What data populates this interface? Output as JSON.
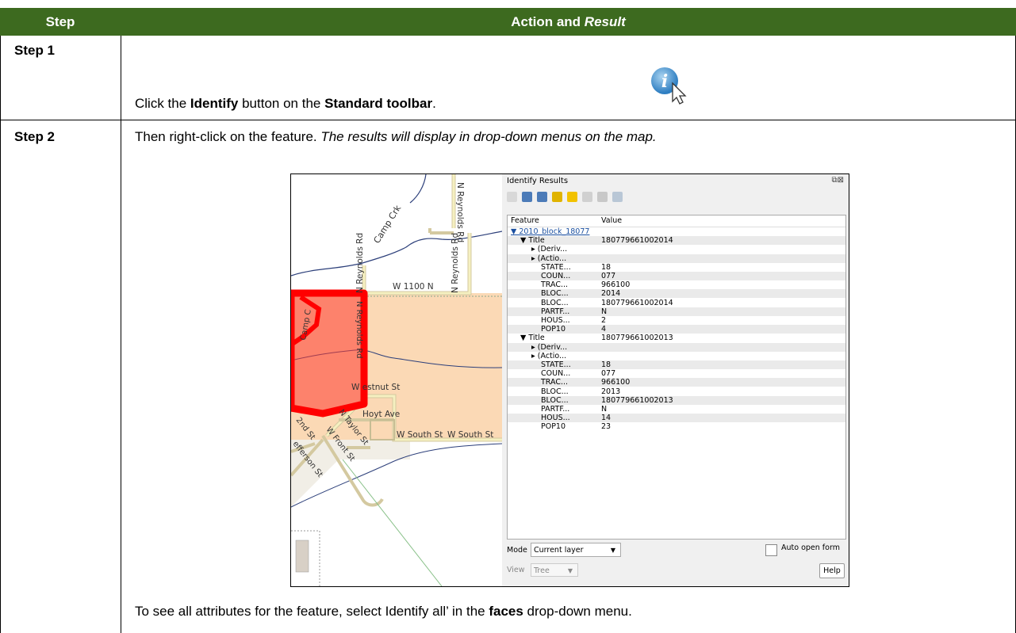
{
  "table": {
    "header": {
      "step": "Step",
      "action": "Action and ",
      "result_word": "Result"
    },
    "step1": {
      "label": "Step 1",
      "t1": "Click the ",
      "b1": "Identify",
      "t2": " button on the ",
      "b2": "Standard toolbar",
      "t3": "."
    },
    "step2": {
      "label": "Step 2",
      "t1": "Then right-click on the feature. ",
      "i1": "The results will display in drop-down menus on the map.",
      "b_t1": "To see all attributes for the feature, select Identify all’ in the ",
      "b_b1": "faces",
      "b_t2": " drop-down menu."
    },
    "colors": {
      "header_bg": "#3d6a1f",
      "header_text": "#ffffff"
    }
  },
  "icon": {
    "name": "identify-tool-icon"
  },
  "map": {
    "labels": {
      "camp_crk": "Camp Crk",
      "n_reynolds_rd_top": "N Reynolds Rd",
      "n_reynolds_rd_mid": "N Reynolds Rd",
      "n_reynolds_rd_left": "N Reynolds Rd",
      "w_1100_n": "W 1100 N",
      "camp_c": "Camp C",
      "n_reynolds_vert": "N Reynolds Rd",
      "chestnut": "W  estnut St",
      "hoyt": "Hoyt Ave",
      "n_taylor": "N Taylor St",
      "w_south_1": "W South St",
      "w_south_2": "W South St",
      "w_front": "W Front St",
      "nd_st": "2nd St",
      "jefferson": "efferson St"
    },
    "colors": {
      "highlight": "#ff0000",
      "fill": "#fbd9b5",
      "road": "#f5f0c0",
      "water": "#2c3f7a"
    }
  },
  "identify_panel": {
    "title": "Identify Results",
    "controls": "⧉⊠",
    "columns": {
      "feature": "Feature",
      "value": "Value"
    },
    "rows": [
      {
        "key": "▼  2010_block_18077",
        "value": "",
        "indent": 0,
        "selected": true
      },
      {
        "key": "▼  Title",
        "value": "180779661002014",
        "indent": 1
      },
      {
        "key": "▸  (Deriv...",
        "value": "",
        "indent": 2
      },
      {
        "key": "▸  (Actio...",
        "value": "",
        "indent": 2
      },
      {
        "key": "STATE...",
        "value": "18",
        "indent": 3
      },
      {
        "key": "COUN...",
        "value": "077",
        "indent": 3
      },
      {
        "key": "TRAC...",
        "value": "966100",
        "indent": 3
      },
      {
        "key": "BLOC...",
        "value": "2014",
        "indent": 3
      },
      {
        "key": "BLOC...",
        "value": "180779661002014",
        "indent": 3
      },
      {
        "key": "PARTF...",
        "value": "N",
        "indent": 3
      },
      {
        "key": "HOUS...",
        "value": "2",
        "indent": 3
      },
      {
        "key": "POP10",
        "value": "4",
        "indent": 3
      },
      {
        "key": "▼  Title",
        "value": "180779661002013",
        "indent": 1
      },
      {
        "key": "▸  (Deriv...",
        "value": "",
        "indent": 2
      },
      {
        "key": "▸  (Actio...",
        "value": "",
        "indent": 2
      },
      {
        "key": "STATE...",
        "value": "18",
        "indent": 3
      },
      {
        "key": "COUN...",
        "value": "077",
        "indent": 3
      },
      {
        "key": "TRAC...",
        "value": "966100",
        "indent": 3
      },
      {
        "key": "BLOC...",
        "value": "2013",
        "indent": 3
      },
      {
        "key": "BLOC...",
        "value": "180779661002013",
        "indent": 3
      },
      {
        "key": "PARTF...",
        "value": "N",
        "indent": 3
      },
      {
        "key": "HOUS...",
        "value": "14",
        "indent": 3
      },
      {
        "key": "POP10",
        "value": "23",
        "indent": 3
      }
    ],
    "mode_label": "Mode",
    "mode_value": "Current layer",
    "auto_open_label": "Auto open form",
    "view_label": "View",
    "view_value": "Tree",
    "help_label": "Help"
  }
}
